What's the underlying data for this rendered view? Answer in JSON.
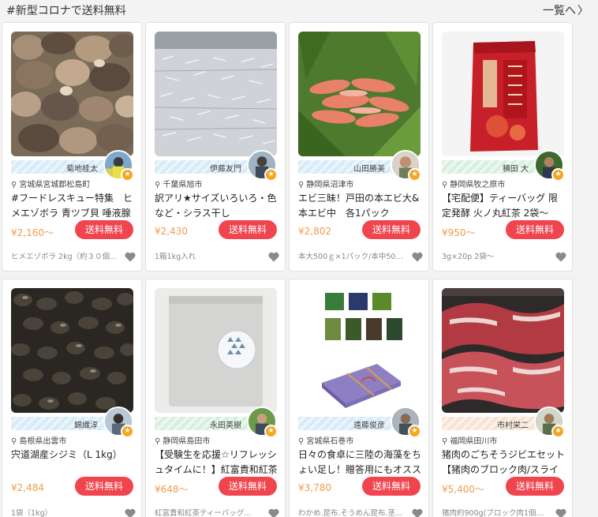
{
  "section": {
    "title": "#新型コロナで送料無料",
    "view_all": "一覧へ"
  },
  "colors": {
    "price": "#f29a4a",
    "ship_button": "#f0454e",
    "badge": "#f5a623"
  },
  "cards": [
    {
      "producer": "菊地桂太",
      "location": "宮城県宮城郡松島町",
      "name": "#フードレスキュー特集　ヒメエゾボラ 青ツブ貝 唾液腺",
      "price": "¥2,160〜",
      "ship_label": "送料無料",
      "spec": "ヒメエゾボラ 2kg（約３０個..."
    },
    {
      "producer": "伊藤友門",
      "location": "千葉県旭市",
      "name": "訳アリ★サイズいろいろ・色など・シラス干し",
      "price": "¥2,430",
      "ship_label": "送料無料",
      "spec": "1箱1kg入れ"
    },
    {
      "producer": "山田勝美",
      "location": "静岡県沼津市",
      "name": "エビ三昧！戸田の本エビ大&本エビ中　各1パック",
      "price": "¥2,802",
      "ship_label": "送料無料",
      "spec": "本大500ｇ×1パック/本中500..."
    },
    {
      "producer": "積田 大",
      "location": "静岡県牧之原市",
      "name": "【宅配便】ティーバッグ 限定発酵 火ノ丸紅茶 2袋〜",
      "price": "¥950〜",
      "ship_label": "送料無料",
      "spec": "3g×20p 2袋〜"
    },
    {
      "producer": "錦織淳",
      "location": "島根県出雲市",
      "name": "宍道湖産シジミ（L 1kg）",
      "price": "¥2,484",
      "ship_label": "送料無料",
      "spec": "1袋（1kg）"
    },
    {
      "producer": "永田英樹",
      "location": "静岡県島田市",
      "name": "【受験生を応援☆リフレッシュタイムに！】紅富貴和紅茶",
      "price": "¥648〜",
      "ship_label": "送料無料",
      "spec": "紅富貴和紅茶ティーバッグ..."
    },
    {
      "producer": "遠藤俊彦",
      "location": "宮城県石巻市",
      "name": "日々の食卓に三陸の海藻をちょい足し！贈答用にもオススメ",
      "price": "¥3,780",
      "ship_label": "送料無料",
      "spec": "わかめ.昆布.そうめん昆布.茎..."
    },
    {
      "producer": "市村栄二",
      "location": "福岡県田川市",
      "name": "猪肉のごちそうジビエセット【猪肉のブロック肉/スライス",
      "price": "¥5,400〜",
      "ship_label": "送料無料",
      "spec": "猪肉約900g(ブロック肉1個、..."
    }
  ]
}
